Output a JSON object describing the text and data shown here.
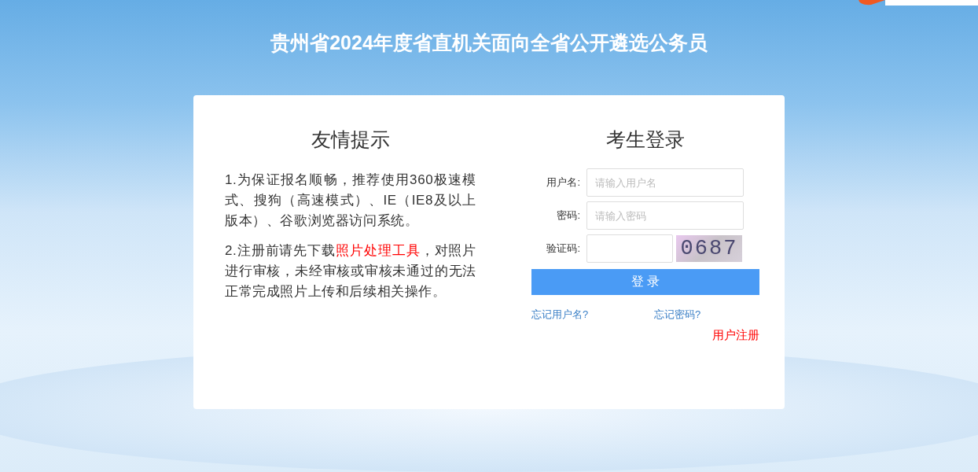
{
  "page_title": "贵州省2024年度省直机关面向全省公开遴选公务员",
  "notice": {
    "title": "友情提示",
    "paragraphs": [
      {
        "before": "1.为保证报名顺畅，推荐使用360极速模式、搜狗（高速模式）、IE（IE8及以上版本）、谷歌浏览器访问系统。"
      },
      {
        "before": "2.注册前请先下载",
        "link": "照片处理工具",
        "after": "，对照片进行审核，未经审核或审核未通过的无法正常完成照片上传和后续相关操作。"
      }
    ]
  },
  "login": {
    "title": "考生登录",
    "fields": [
      {
        "kind": "text",
        "label": "用户名:",
        "placeholder": "请输入用户名"
      },
      {
        "kind": "password",
        "label": "密码:",
        "placeholder": "请输入密码"
      },
      {
        "kind": "captcha",
        "label": "验证码:",
        "captcha": "0687"
      }
    ],
    "submit": "登 录",
    "forgot_username": "忘记用户名?",
    "forgot_password": "忘记密码?",
    "register": "用户注册"
  }
}
